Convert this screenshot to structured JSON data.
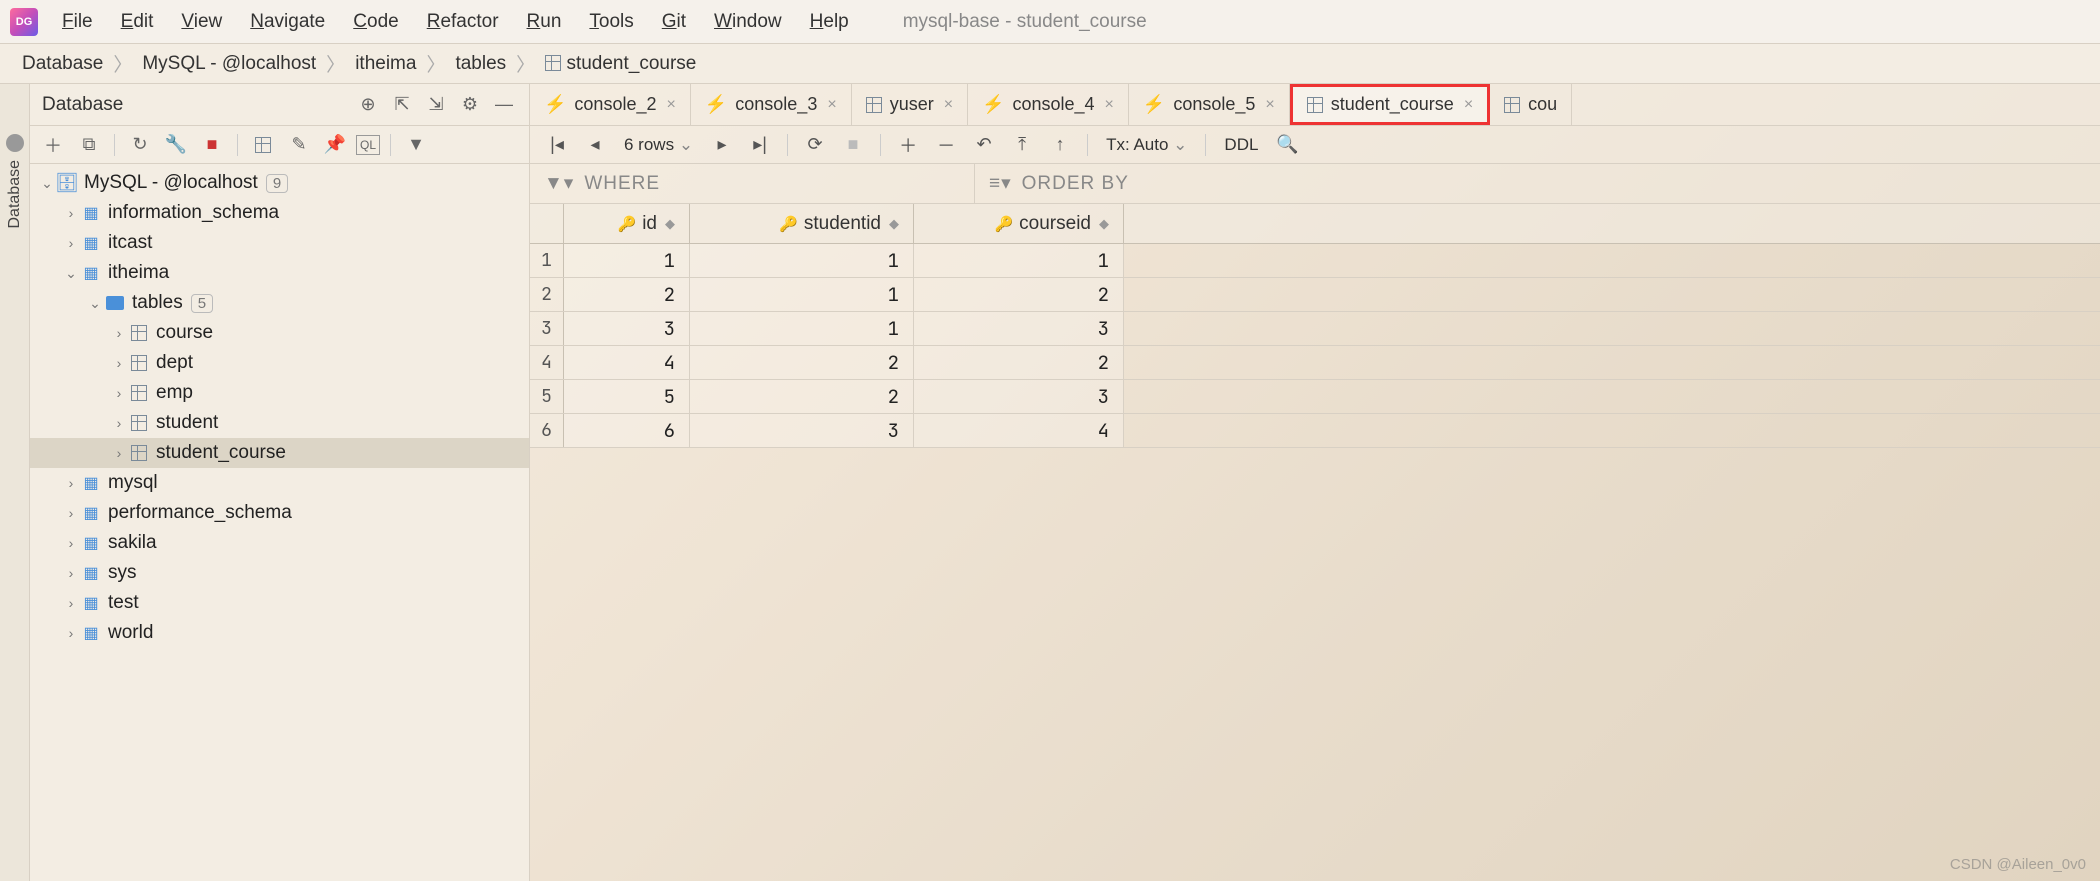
{
  "window_title": "mysql-base - student_course",
  "menu": [
    "File",
    "Edit",
    "View",
    "Navigate",
    "Code",
    "Refactor",
    "Run",
    "Tools",
    "Git",
    "Window",
    "Help"
  ],
  "breadcrumb": [
    "Database",
    "MySQL - @localhost",
    "itheima",
    "tables",
    "student_course"
  ],
  "db_panel": {
    "title": "Database"
  },
  "tree": {
    "root": {
      "label": "MySQL - @localhost",
      "badge": "9"
    },
    "schemas_top": [
      "information_schema",
      "itcast"
    ],
    "active_schema": "itheima",
    "tables_label": "tables",
    "tables_badge": "5",
    "tables": [
      "course",
      "dept",
      "emp",
      "student",
      "student_course"
    ],
    "schemas_bottom": [
      "mysql",
      "performance_schema",
      "sakila",
      "sys",
      "test",
      "world"
    ]
  },
  "tabs": [
    {
      "label": "console_2",
      "type": "console"
    },
    {
      "label": "console_3",
      "type": "console"
    },
    {
      "label": "yuser",
      "type": "table"
    },
    {
      "label": "console_4",
      "type": "console"
    },
    {
      "label": "console_5",
      "type": "console"
    },
    {
      "label": "student_course",
      "type": "table",
      "highlighted": true
    },
    {
      "label": "cou",
      "type": "table",
      "truncated": true
    }
  ],
  "editor_toolbar": {
    "rows_label": "6 rows",
    "tx_label": "Tx: Auto",
    "ddl_label": "DDL"
  },
  "filter": {
    "where": "WHERE",
    "order": "ORDER BY"
  },
  "columns": [
    "id",
    "studentid",
    "courseid"
  ],
  "rows": [
    {
      "n": "1",
      "id": "1",
      "studentid": "1",
      "courseid": "1"
    },
    {
      "n": "2",
      "id": "2",
      "studentid": "1",
      "courseid": "2"
    },
    {
      "n": "3",
      "id": "3",
      "studentid": "1",
      "courseid": "3"
    },
    {
      "n": "4",
      "id": "4",
      "studentid": "2",
      "courseid": "2"
    },
    {
      "n": "5",
      "id": "5",
      "studentid": "2",
      "courseid": "3"
    },
    {
      "n": "6",
      "id": "6",
      "studentid": "3",
      "courseid": "4"
    }
  ],
  "watermark": "CSDN @Aileen_0v0"
}
